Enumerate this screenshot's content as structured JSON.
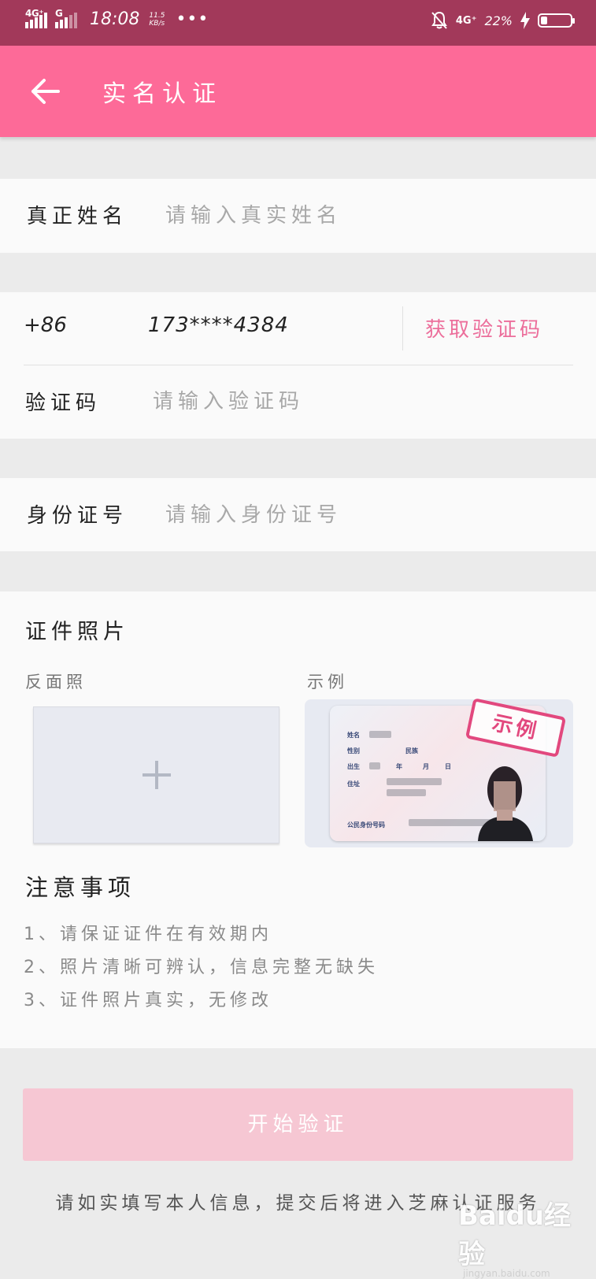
{
  "status_bar": {
    "network1": "4G⁺",
    "network2": "G",
    "time": "18:08",
    "speed_value": "11.5",
    "speed_unit": "KB/s",
    "more": "•••",
    "network_right": "4G⁺",
    "battery_text": "22%",
    "battery_level": 0.22
  },
  "app_bar": {
    "back_icon": "arrow-left-icon",
    "title": "实名认证"
  },
  "form": {
    "name": {
      "label": "真正姓名",
      "placeholder": "请输入真实姓名"
    },
    "phone": {
      "prefix": "+86",
      "value": "173****4384",
      "get_code": "获取验证码"
    },
    "code": {
      "label": "验证码",
      "placeholder": "请输入验证码"
    },
    "id_number": {
      "label": "身份证号",
      "placeholder": "请输入身份证号"
    }
  },
  "photo_section": {
    "title": "证件照片",
    "back_label": "反面照",
    "example_label": "示例",
    "upload_icon": "plus-icon",
    "example_stamp": "示例",
    "id_card_fields": [
      "姓名",
      "性别",
      "民族",
      "出生",
      "年",
      "月",
      "日",
      "住址",
      "公民身份号码"
    ]
  },
  "notes": {
    "title": "注意事项",
    "items": [
      "1、请保证证件在有效期内",
      "2、照片清晰可辨认，信息完整无缺失",
      "3、证件照片真实，无修改"
    ]
  },
  "start_button": "开始验证",
  "footer_note": "请如实填写本人信息，提交后将进入芝麻认证服务",
  "watermark": {
    "main": "Baidu经验",
    "sub": "jingyan.baidu.com"
  },
  "colors": {
    "status_bar": "#a2395a",
    "app_bar": "#fd6a98",
    "accent": "#ec6e9b",
    "button_disabled": "#f6c7d3"
  }
}
